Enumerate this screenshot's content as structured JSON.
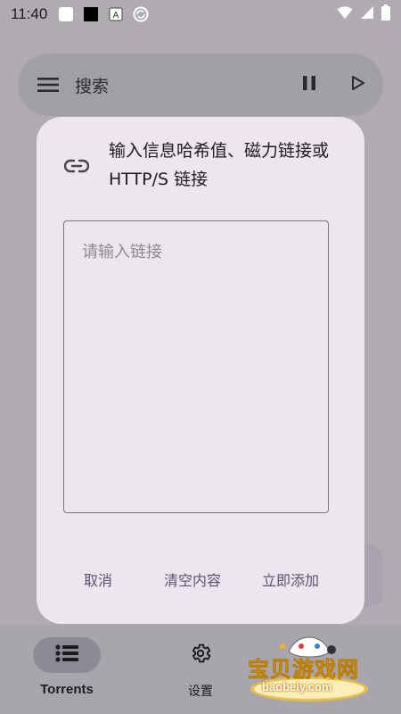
{
  "status_bar": {
    "time": "11:40",
    "icons": [
      "white-square-icon",
      "black-square-icon",
      "a-badge-icon",
      "sync-icon"
    ],
    "right_icons": [
      "wifi-icon",
      "signal-icon",
      "battery-icon"
    ]
  },
  "search": {
    "placeholder": "搜索",
    "icons": [
      "menu-icon",
      "pause-icon",
      "play-icon"
    ]
  },
  "dialog": {
    "icon": "link-icon",
    "title": "输入信息哈希值、磁力链接或 HTTP/S 链接",
    "input_placeholder": "请输入链接",
    "input_value": "",
    "actions": {
      "cancel": "取消",
      "clear": "清空内容",
      "add": "立即添加"
    }
  },
  "nav": {
    "items": [
      {
        "label": "Torrents",
        "icon": "list-icon",
        "active": true
      },
      {
        "label": "设置",
        "icon": "gear-icon",
        "active": false
      }
    ]
  },
  "watermark": {
    "text": "宝贝游戏网",
    "url": "baobeiy.com"
  },
  "colors": {
    "scrim": "#b0abb2",
    "dialog_bg": "#ece6ef",
    "button_text": "#5b5370",
    "nav_active": "#8e8a95"
  }
}
